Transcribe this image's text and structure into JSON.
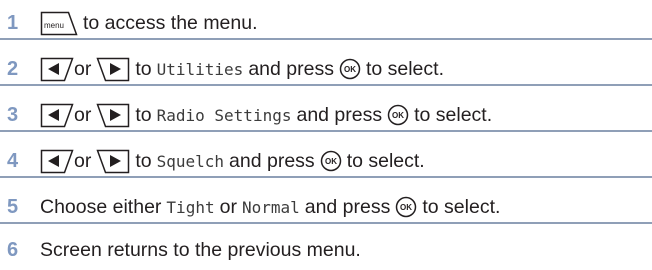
{
  "colors": {
    "step_number": "#7f98c0",
    "divider": "#8f9fb7",
    "text": "#231f20"
  },
  "icons": {
    "menu": "menu-key-icon",
    "left": "left-nav-key-icon",
    "right": "right-nav-key-icon",
    "ok": "ok-key-icon"
  },
  "menu_key_label": "menu",
  "ok_key_label": "OK",
  "steps": [
    {
      "number": "1",
      "text": "to access the menu."
    },
    {
      "number": "2",
      "or": "or",
      "to": "to",
      "target": "Utilities",
      "and_press": "and press",
      "to_select": "to select."
    },
    {
      "number": "3",
      "or": "or",
      "to": "to",
      "target": "Radio Settings",
      "and_press": "and press",
      "to_select": "to select."
    },
    {
      "number": "4",
      "or": "or",
      "to": "to",
      "target": "Squelch",
      "and_press": "and press",
      "to_select": "to select."
    },
    {
      "number": "5",
      "prefix": "Choose either",
      "option_a": "Tight",
      "or": "or",
      "option_b": "Normal",
      "and_press": "and press",
      "to_select": "to select."
    },
    {
      "number": "6",
      "text": "Screen returns to the previous menu."
    }
  ]
}
